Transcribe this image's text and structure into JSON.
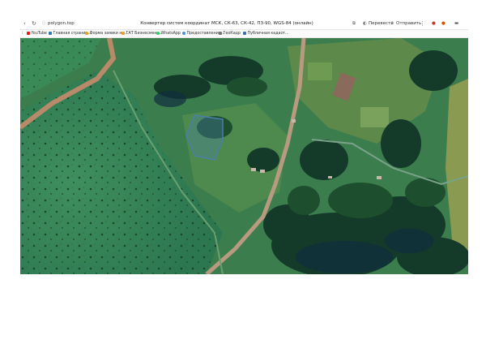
{
  "browser": {
    "nav": {
      "back": "‹",
      "reload": "↻"
    },
    "address": "polygon.top",
    "title": "Конвертер систем координат МСК, СК-63, СК-42, ПЗ-90, WGS-84 (онлайн)",
    "actions": {
      "translate": "Перевести",
      "share": "Отправить",
      "menu": "⋮"
    },
    "bookmarks": [
      {
        "label": "YouTube",
        "color": "#e62117"
      },
      {
        "label": "Главная страниц...",
        "color": "#2a7ab8"
      },
      {
        "label": "Форма заявки на...",
        "color": "#e0a020"
      },
      {
        "label": "ГАТ Бизнесмен ...",
        "color": "#f0a030"
      },
      {
        "label": "WhatsApp",
        "color": "#25d366"
      },
      {
        "label": "Предоставление...",
        "color": "#4a90d9"
      },
      {
        "label": "ГеоКадр",
        "color": "#777777"
      },
      {
        "label": "Публичная кадаст...",
        "color": "#3a6fb0"
      }
    ],
    "colors": {
      "map_accent": "#4a7fa8"
    }
  }
}
